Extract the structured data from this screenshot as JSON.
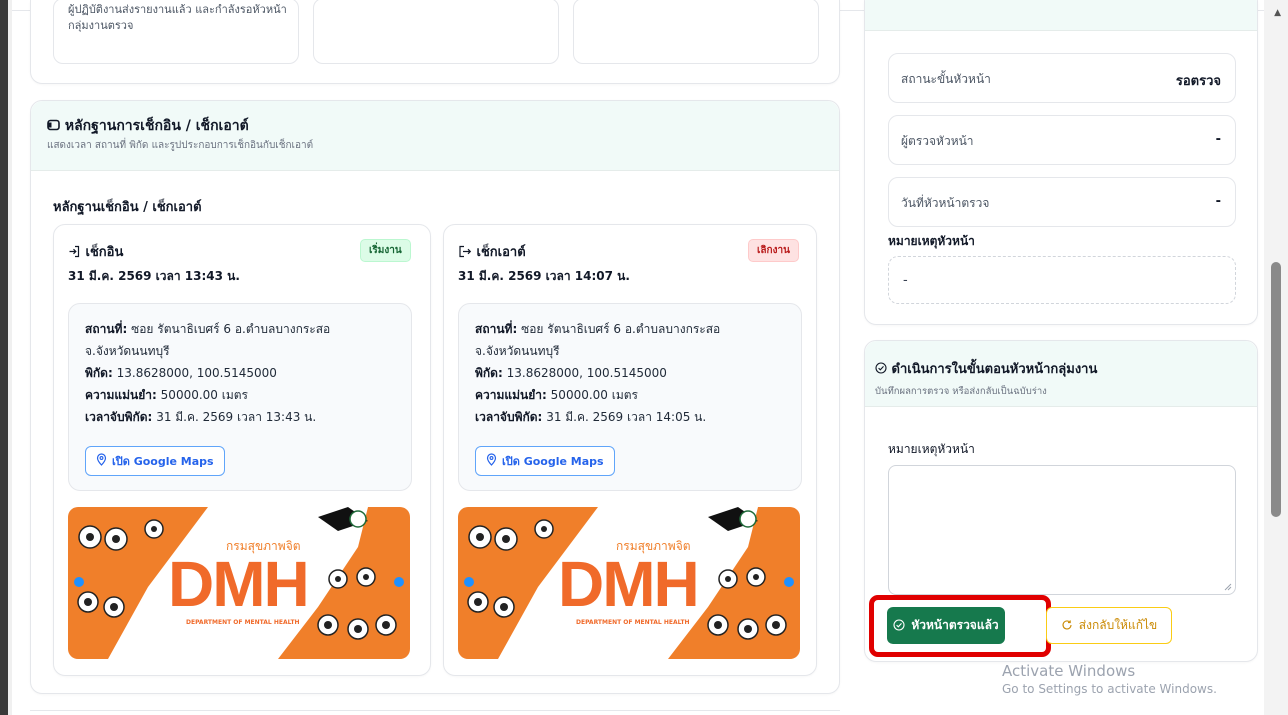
{
  "top_cards": {
    "card1_text": "ผู้ปฏิบัติงานส่งรายงานแล้ว และกำลังรอหัวหน้ากลุ่มงานตรวจ"
  },
  "evidence": {
    "title": "หลักฐานการเช็กอิน / เช็กเอาต์",
    "subtitle": "แสดงเวลา สถานที่ พิกัด และรูปประกอบการเช็กอินกับเช็กเอาต์",
    "heading": "หลักฐานเช็กอิน / เช็กเอาต์",
    "checkin": {
      "title": "เช็กอิน",
      "badge": "เริ่มงาน",
      "datetime": "31 มี.ค. 2569 เวลา 13:43 น.",
      "place_label": "สถานที่:",
      "place_line1": "ซอย รัตนาธิเบศร์ 6 อ.ตำบลบางกระสอ",
      "place_line2": "จ.จังหวัดนนทบุรี",
      "coord_label": "พิกัด:",
      "coord_value": "13.8628000, 100.5145000",
      "acc_label": "ความแม่นยำ:",
      "acc_value": "50000.00 เมตร",
      "time_label": "เวลาจับพิกัด:",
      "time_value": "31 มี.ค. 2569 เวลา 13:43 น.",
      "maps_label": "เปิด Google Maps"
    },
    "checkout": {
      "title": "เช็กเอาต์",
      "badge": "เลิกงาน",
      "datetime": "31 มี.ค. 2569 เวลา 14:07 น.",
      "place_label": "สถานที่:",
      "place_line1": "ซอย รัตนาธิเบศร์ 6 อ.ตำบลบางกระสอ",
      "place_line2": "จ.จังหวัดนนทบุรี",
      "coord_label": "พิกัด:",
      "coord_value": "13.8628000, 100.5145000",
      "acc_label": "ความแม่นยำ:",
      "acc_value": "50000.00 เมตร",
      "time_label": "เวลาจับพิกัด:",
      "time_value": "31 มี.ค. 2569 เวลา 14:05 น.",
      "maps_label": "เปิด Google Maps"
    },
    "image": {
      "org_thai": "กรมสุขภาพจิต",
      "big": "DMH",
      "org_en": "DEPARTMENT OF MENTAL HEALTH"
    }
  },
  "head_status": {
    "stage_label": "สถานะขั้นหัวหน้า",
    "stage_value": "รอตรวจ",
    "reviewer_label": "ผู้ตรวจหัวหน้า",
    "reviewer_value": "-",
    "date_label": "วันที่หัวหน้าตรวจ",
    "date_value": "-",
    "note_label": "หมายเหตุหัวหน้า",
    "note_value": "-"
  },
  "head_action": {
    "title": "ดำเนินการในขั้นตอนหัวหน้ากลุ่มงาน",
    "subtitle": "บันทึกผลการตรวจ หรือส่งกลับเป็นฉบับร่าง",
    "note_label": "หมายเหตุหัวหน้า",
    "note_placeholder": "",
    "approve_label": "หัวหน้าตรวจแล้ว",
    "return_label": "ส่งกลับให้แก้ไข"
  },
  "watermark": {
    "title": "Activate Windows",
    "subtitle": "Go to Settings to activate Windows."
  },
  "colors": {
    "approve": "#16794d",
    "highlight": "#e00000",
    "return": "#ca8a04",
    "link": "#2563eb"
  }
}
